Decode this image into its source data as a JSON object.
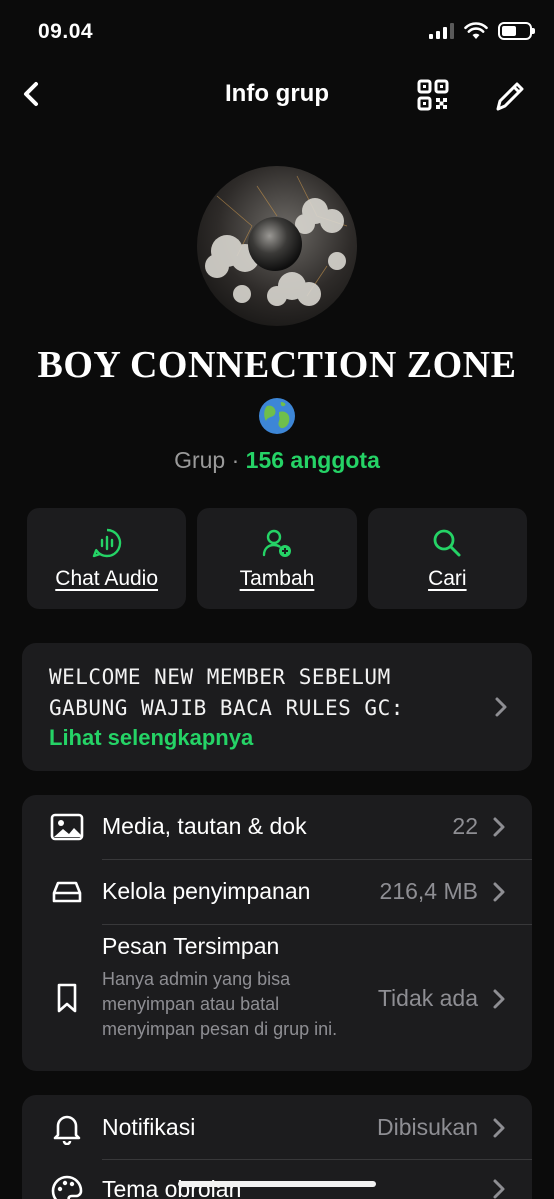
{
  "status": {
    "time": "09.04"
  },
  "nav": {
    "title": "Info grup"
  },
  "group": {
    "name": "BOY CONNECTION ZONE",
    "type_label": "Grup · ",
    "members_label": "156 anggota"
  },
  "actions": [
    {
      "label": "Chat Audio",
      "icon": "audio-wave-icon"
    },
    {
      "label": "Tambah",
      "icon": "add-person-icon"
    },
    {
      "label": "Cari",
      "icon": "search-icon"
    }
  ],
  "description": {
    "line1": "WELCOME NEW MEMBER SEBELUM",
    "line2": "GABUNG WAJIB BACA RULES GC:",
    "more": "Lihat selengkapnya"
  },
  "media_card": {
    "media": {
      "label": "Media, tautan & dok",
      "value": "22"
    },
    "storage": {
      "label": "Kelola penyimpanan",
      "value": "216,4 MB"
    },
    "saved": {
      "label": "Pesan Tersimpan",
      "description": "Hanya admin yang bisa menyimpan atau batal menyimpan pesan di grup ini.",
      "value": "Tidak ada"
    }
  },
  "settings_card": {
    "notifications": {
      "label": "Notifikasi",
      "value": "Dibisukan"
    },
    "theme": {
      "label": "Tema obrolan"
    }
  },
  "colors": {
    "accent": "#25d366",
    "card": "#1c1c1e",
    "background": "#0b0b0b"
  }
}
